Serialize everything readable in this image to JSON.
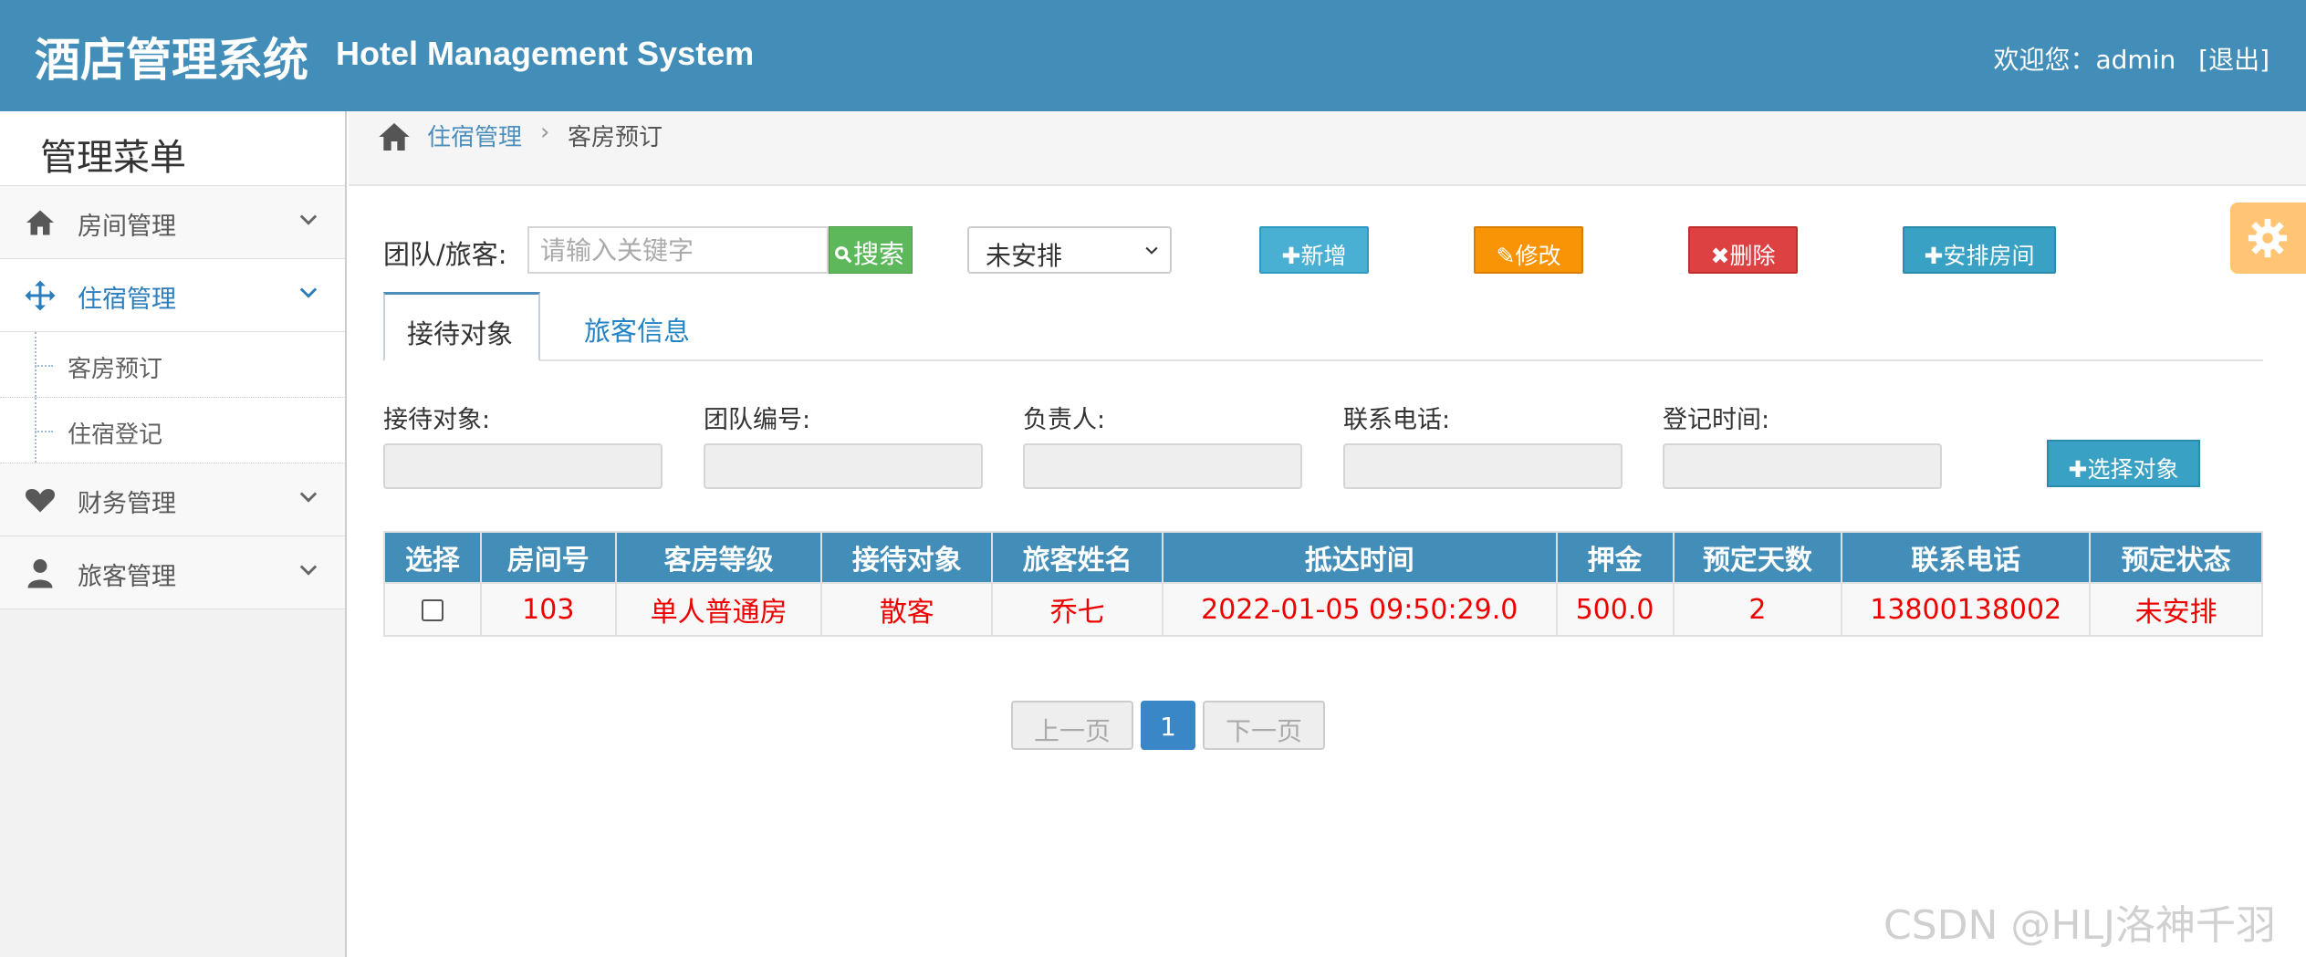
{
  "header": {
    "title_cn": "酒店管理系统",
    "title_en": "Hotel Management System",
    "welcome": "欢迎您：admin",
    "logout": "[退出]"
  },
  "sidebar": {
    "title": "管理菜单",
    "items": [
      {
        "label": "房间管理",
        "icon": "home-icon"
      },
      {
        "label": "住宿管理",
        "icon": "move-arrows-icon"
      },
      {
        "label": "财务管理",
        "icon": "heart-icon"
      },
      {
        "label": "旅客管理",
        "icon": "user-icon"
      }
    ],
    "subitems": [
      "客房预订",
      "住宿登记"
    ]
  },
  "breadcrumb": {
    "parent": "住宿管理",
    "current": "客房预订"
  },
  "toolbar": {
    "label": "团队/旅客:",
    "search_placeholder": "请输入关键字",
    "search_button": "搜索",
    "status_select": "未安排",
    "add": "新增",
    "edit": "修改",
    "delete": "删除",
    "arrange": "安排房间"
  },
  "tabs": [
    "接待对象",
    "旅客信息"
  ],
  "form": {
    "labels": [
      "接待对象:",
      "团队编号:",
      "负责人:",
      "联系电话:",
      "登记时间:"
    ],
    "select_button": "选择对象"
  },
  "table": {
    "headers": [
      "选择",
      "房间号",
      "客房等级",
      "接待对象",
      "旅客姓名",
      "抵达时间",
      "押金",
      "预定天数",
      "联系电话",
      "预定状态"
    ],
    "rows": [
      [
        "",
        "103",
        "单人普通房",
        "散客",
        "乔七",
        "2022-01-05 09:50:29.0",
        "500.0",
        "2",
        "13800138002",
        "未安排"
      ]
    ]
  },
  "pager": {
    "prev": "上一页",
    "current": "1",
    "next": "下一页"
  },
  "watermark": "CSDN @HLJ洛神千羽",
  "colors": {
    "header": "#438eb9",
    "accent": "#2b7dbc",
    "row_text": "#e00000"
  }
}
